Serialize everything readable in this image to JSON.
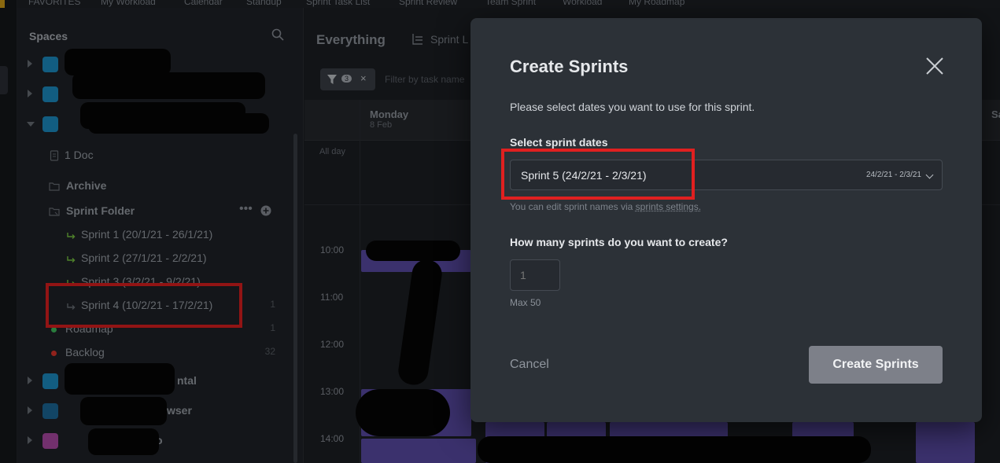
{
  "topnav": {
    "items": [
      "FAVORITES",
      "My Workload",
      "Calendar",
      "Standup",
      "Sprint Task List",
      "Sprint Review",
      "Team Sprint",
      "Workload",
      "My Roadmap"
    ]
  },
  "sidebar": {
    "title": "Spaces",
    "doc_label": "1 Doc",
    "archive_label": "Archive",
    "folder_label": "Sprint Folder",
    "sprints": [
      {
        "label": "Sprint 1 (20/1/21 - 26/1/21)"
      },
      {
        "label": "Sprint 2 (27/1/21 - 2/2/21)"
      },
      {
        "label": "Sprint 3 (3/2/21 - 9/2/21)"
      },
      {
        "label": "Sprint 4 (10/2/21 - 17/2/21)",
        "count": "1"
      }
    ],
    "roadmap": {
      "label": "Roadmap",
      "count": "1"
    },
    "backlog": {
      "label": "Backlog",
      "count": "32"
    },
    "partial_spaces": [
      "ntal",
      "wser",
      "o"
    ],
    "colors": {
      "accent_sprint": "#7ac943",
      "roadmap_dot": "#3fbf5f",
      "backlog_dot": "#e0352b"
    }
  },
  "main": {
    "title": "Everything",
    "tab_label": "Sprint L",
    "filter_count": "3",
    "filter_placeholder": "Filter by task name",
    "day_name": "Monday",
    "day_date": "8 Feb",
    "right_day": "Sa",
    "all_day": "All day",
    "hours": [
      "10:00",
      "11:00",
      "12:00",
      "13:00",
      "14:00"
    ]
  },
  "modal": {
    "title": "Create Sprints",
    "description": "Please select dates you want to use for this sprint.",
    "dates_label": "Select sprint dates",
    "selected_sprint": "Sprint 5 (24/2/21 - 2/3/21)",
    "selected_range": "24/2/21 - 2/3/21",
    "hint_prefix": "You can edit sprint names via ",
    "hint_link": "sprints settings.",
    "count_label": "How many sprints do you want to create?",
    "count_value": "1",
    "max_label": "Max 50",
    "cancel_label": "Cancel",
    "create_label": "Create Sprints",
    "colors": {
      "button": "#7d8089",
      "background": "#2c3137",
      "highlight": "#e02020"
    }
  }
}
